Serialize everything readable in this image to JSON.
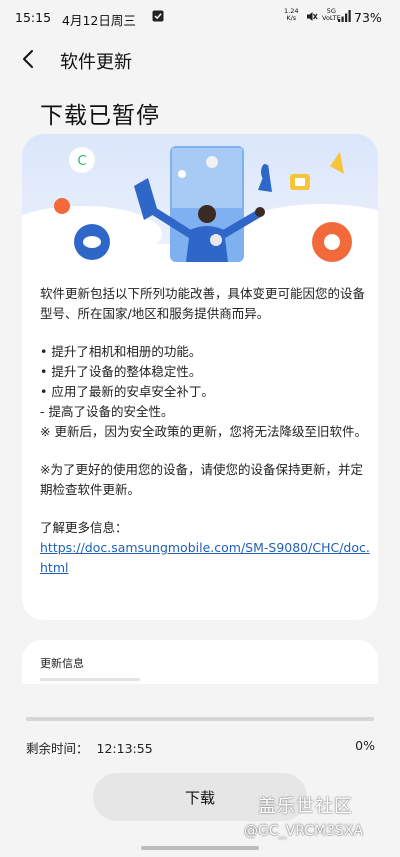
{
  "status_bar": {
    "time": "15:15",
    "date": "4月12日周三",
    "speed_value": "1.24",
    "speed_unit": "K/s",
    "net_top": "5G",
    "net_bottom": "VoLTE",
    "battery": "73%"
  },
  "header": {
    "title": "软件更新"
  },
  "page": {
    "title": "下载已暂停"
  },
  "content": {
    "intro": "软件更新包括以下所列功能改善，具体变更可能因您的设备型号、所在国家/地区和服务提供商而异。",
    "bullets": [
      "• 提升了相机和相册的功能。",
      "• 提升了设备的整体稳定性。",
      "• 应用了最新的安卓安全补丁。",
      " - 提高了设备的安全性。",
      "※ 更新后，因为安全政策的更新，您将无法降级至旧软件。"
    ],
    "note": "※为了更好的使用您的设备，请使您的设备保持更新，并定期检查软件更新。",
    "more_label": "了解更多信息：",
    "link": "https://doc.samsungmobile.com/SM-S9080/CHC/doc.html"
  },
  "info_card": {
    "title": "更新信息"
  },
  "progress": {
    "remaining_label": "剩余时间：",
    "remaining_time": "12:13:55",
    "percent_text": "0%",
    "fraction": 0.0
  },
  "download_button": {
    "label": "下载"
  },
  "watermark": {
    "main": "盖乐世社区",
    "sub": "@GC_VRCM3SXA"
  },
  "colors": {
    "accent": "#3b6fd6",
    "link": "#1f5fb8",
    "illustration_blue": "#2f67c9",
    "illustration_orange": "#f26a3c"
  }
}
